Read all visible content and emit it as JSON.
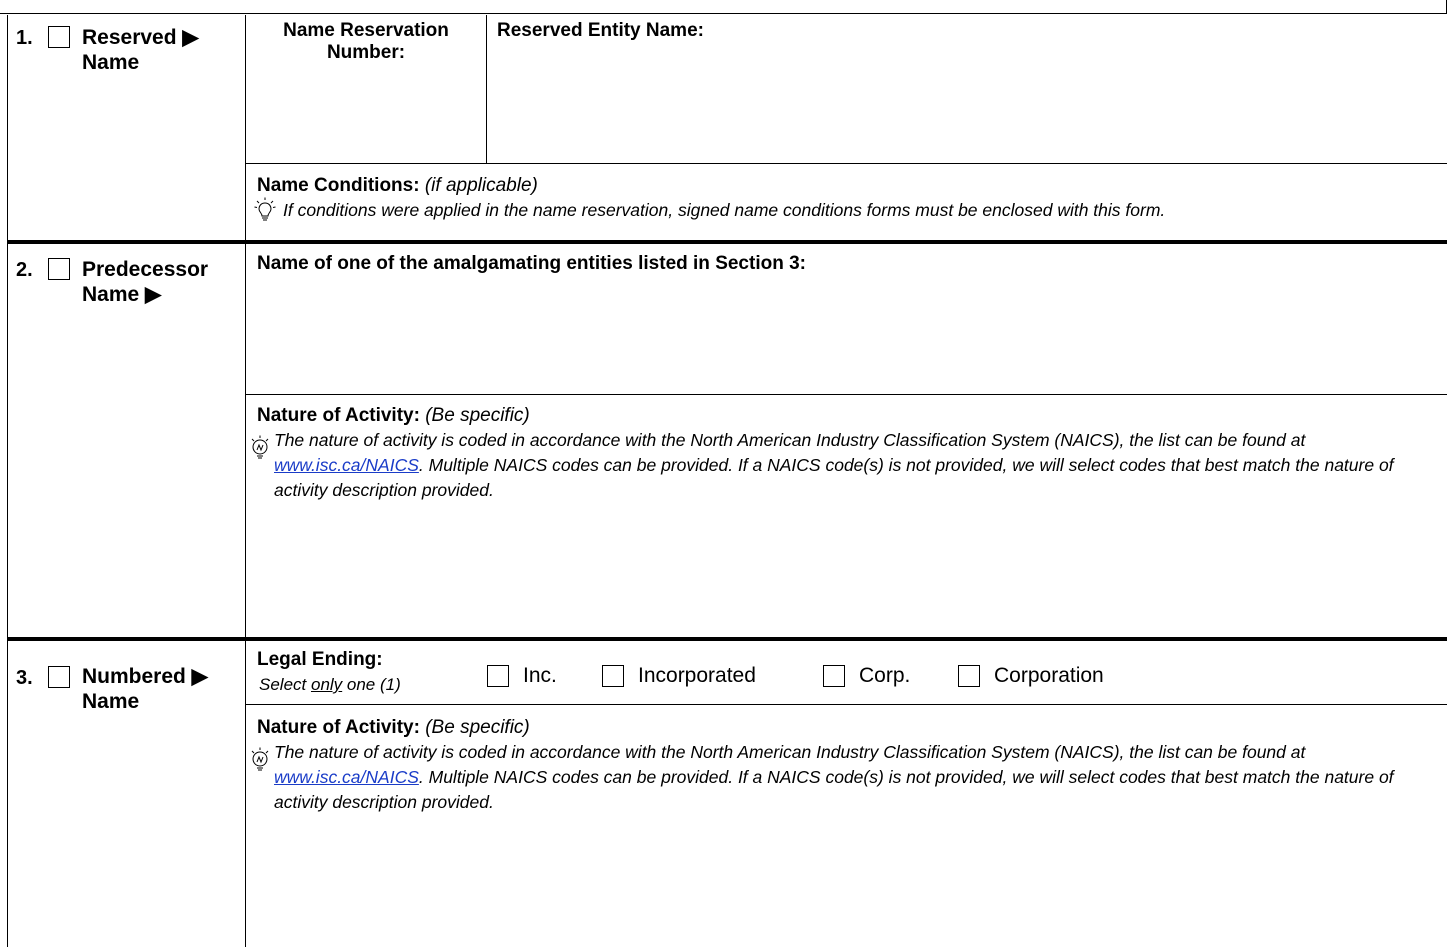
{
  "sections": [
    {
      "number": "1.",
      "title_line1": "Reserved ▶",
      "title_line2": "Name",
      "reservation_number_label_line1": "Name Reservation",
      "reservation_number_label_line2": "Number:",
      "reserved_entity_label": "Reserved Entity Name:",
      "conditions_label": "Name Conditions:",
      "conditions_hint": "(if applicable)",
      "conditions_note": "If conditions were applied in the name reservation, signed name conditions forms must be enclosed with this form."
    },
    {
      "number": "2.",
      "title_line1": "Predecessor",
      "title_line2": "Name ▶",
      "predecessor_label": "Name of one of the amalgamating entities listed in Section 3:",
      "activity_label": "Nature of Activity:",
      "activity_hint": "(Be specific)",
      "activity_note_pre": "The nature of activity is coded in accordance with the North American Industry Classification System (NAICS), the list can be found at ",
      "activity_note_link": "www.isc.ca/NAICS",
      "activity_note_post": ". Multiple NAICS codes can be provided. If a NAICS code(s) is not provided, we will select codes that best match the nature of activity description provided."
    },
    {
      "number": "3.",
      "title_line1": "Numbered ▶",
      "title_line2": "Name",
      "legal_ending_label": "Legal Ending:",
      "legal_ending_hint_pre": "Select ",
      "legal_ending_hint_only": "only",
      "legal_ending_hint_post": " one (1)",
      "legal_ending_options": [
        "Inc.",
        "Incorporated",
        "Corp.",
        "Corporation"
      ],
      "activity_label": "Nature of Activity:",
      "activity_hint": "(Be specific)",
      "activity_note_pre": "The nature of activity is coded in accordance with the North American Industry Classification System (NAICS), the list can be found at ",
      "activity_note_link": "www.isc.ca/NAICS",
      "activity_note_post": ". Multiple NAICS codes can be provided. If a NAICS code(s) is not provided, we will select codes that best match the nature of activity description provided."
    }
  ],
  "icons": {
    "tip": "lightbulb-icon"
  },
  "colors": {
    "link": "#1a3cc8"
  }
}
